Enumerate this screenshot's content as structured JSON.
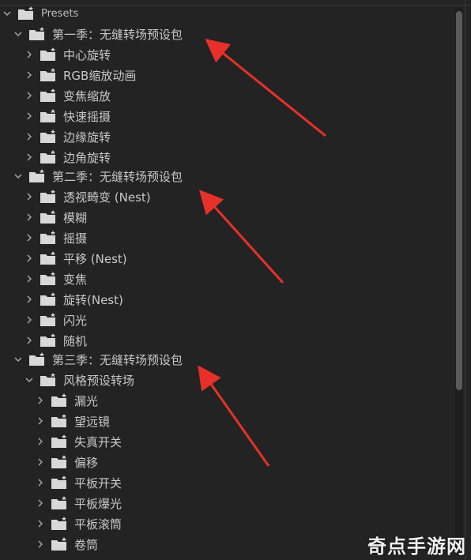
{
  "root": {
    "label": "Presets"
  },
  "season1": {
    "label": "第一季：无缝转场预设包",
    "items": [
      "中心旋转",
      "RGB缩放动画",
      "变焦缩放",
      "快速摇摄",
      "边缘旋转",
      "边角旋转"
    ]
  },
  "season2": {
    "label": "第二季：无缝转场预设包",
    "items": [
      "透视畸变 (Nest)",
      "模糊",
      "摇摄",
      "平移 (Nest)",
      "变焦",
      "旋转(Nest)",
      "闪光",
      "随机"
    ]
  },
  "season3": {
    "label": "第三季：无缝转场预设包",
    "subfolder": {
      "label": "风格预设转场",
      "items": [
        "漏光",
        "望远镜",
        "失真开关",
        "偏移",
        "平板开关",
        "平板爆光",
        "平板滚筒",
        "卷筒"
      ]
    }
  },
  "watermark": "奇点手游网",
  "colors": {
    "background": "#232323",
    "text": "#c8c8c8",
    "arrow": "#e8302a"
  }
}
